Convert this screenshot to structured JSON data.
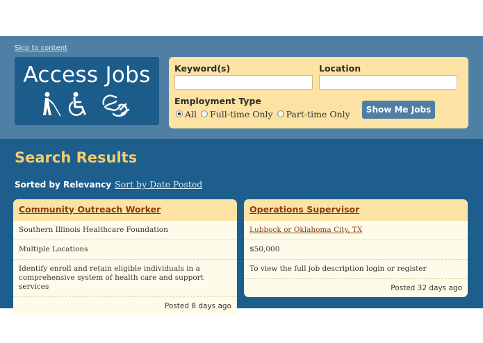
{
  "skip_link": "Skip to content",
  "logo": {
    "text": "Access Jobs",
    "icons": [
      "blind-person-icon",
      "wheelchair-icon",
      "sign-language-icon"
    ]
  },
  "search": {
    "keyword_label": "Keyword(s)",
    "keyword_value": "",
    "location_label": "Location",
    "location_value": "",
    "employment_label": "Employment Type",
    "options": [
      {
        "label": "All",
        "checked": true
      },
      {
        "label": "Full-time Only",
        "checked": false
      },
      {
        "label": "Part-time Only",
        "checked": false
      }
    ],
    "submit_label": "Show Me Jobs"
  },
  "results": {
    "title": "Search Results",
    "sorted_by": "Sorted by Relevancy",
    "sort_alt": "Sort by Date Posted",
    "jobs": [
      {
        "title": "Community Outreach Worker",
        "rows": [
          {
            "text": "Southern Illinois Healthcare Foundation",
            "link": false
          },
          {
            "text": "Multiple Locations",
            "link": false
          },
          {
            "text": "Identify enroll and retain eligible individuals in a comprehensive system of health care and support services",
            "link": false
          }
        ],
        "posted": "Posted 8 days ago"
      },
      {
        "title": "Operations Supervisor",
        "rows": [
          {
            "text": "Lubbock or Oklahoma City, TX",
            "link": true
          },
          {
            "text": "$50,000",
            "link": false
          },
          {
            "text": "To view the full job description login or register",
            "link": false
          }
        ],
        "posted": "Posted 32 days ago"
      }
    ]
  },
  "colors": {
    "top_band": "#4f7fa4",
    "main_band": "#1d5e8d",
    "panel": "#fde3a3",
    "title_accent": "#f4cf6a",
    "link": "#8b3a16"
  }
}
